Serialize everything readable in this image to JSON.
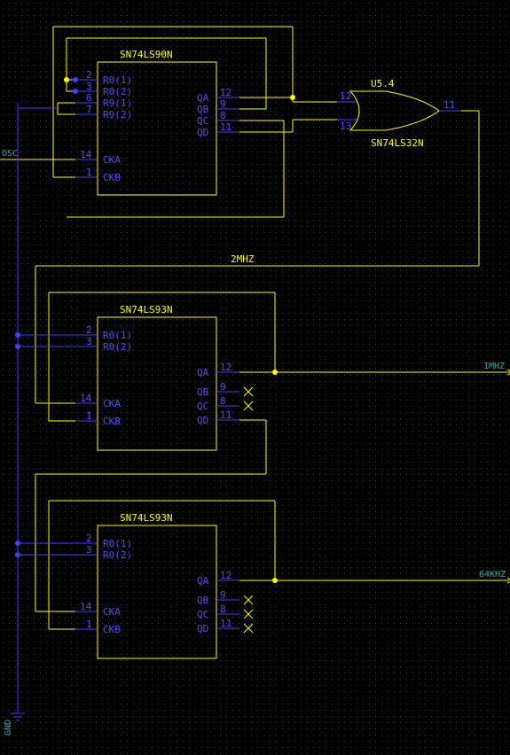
{
  "chip1": {
    "part": "SN74LS90N",
    "pins": {
      "r01": "R0(1)",
      "r02": "R0(2)",
      "r91": "R9(1)",
      "r92": "R9(2)",
      "cka": "CKA",
      "ckb": "CKB",
      "qa": "QA",
      "qb": "QB",
      "qc": "QC",
      "qd": "QD"
    },
    "pinNums": {
      "r01": "2",
      "r02": "3",
      "r91": "6",
      "r92": "7",
      "cka": "14",
      "ckb": "1",
      "qa": "12",
      "qb": "9",
      "qc": "8",
      "qd": "11"
    }
  },
  "chip2": {
    "part": "SN74LS93N",
    "pins": {
      "r01": "R0(1)",
      "r02": "R0(2)",
      "cka": "CKA",
      "ckb": "CKB",
      "qa": "QA",
      "qb": "QB",
      "qc": "QC",
      "qd": "QD"
    },
    "pinNums": {
      "r01": "2",
      "r02": "3",
      "cka": "14",
      "ckb": "1",
      "qa": "12",
      "qb": "9",
      "qc": "8",
      "qd": "11"
    }
  },
  "chip3": {
    "part": "SN74LS93N",
    "pins": {
      "r01": "R0(1)",
      "r02": "R0(2)",
      "cka": "CKA",
      "ckb": "CKB",
      "qa": "QA",
      "qb": "QB",
      "qc": "QC",
      "qd": "QD"
    },
    "pinNums": {
      "r01": "2",
      "r02": "3",
      "cka": "14",
      "ckb": "1",
      "qa": "12",
      "qb": "9",
      "qc": "8",
      "qd": "11"
    }
  },
  "gate": {
    "ref": "U5.4",
    "part": "SN74LS32N",
    "pinNums": {
      "a": "12",
      "b": "13",
      "y": "11"
    }
  },
  "nets": {
    "osc": "OSC",
    "gnd": "GND",
    "twomhz": "2MHZ",
    "onemhz": "1MHZ",
    "sixtyfour": "64KHZ"
  }
}
